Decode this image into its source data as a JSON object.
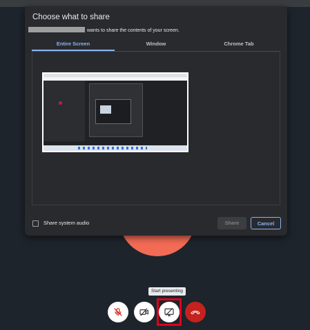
{
  "dialog": {
    "title": "Choose what to share",
    "subtitle": "wants to share the contents of your screen.",
    "tabs": [
      {
        "label": "Entire Screen",
        "active": true
      },
      {
        "label": "Window",
        "active": false
      },
      {
        "label": "Chrome Tab",
        "active": false
      }
    ],
    "share_audio_label": "Share system audio",
    "share_audio_checked": false,
    "share_button": "Share",
    "cancel_button": "Cancel"
  },
  "call_controls": {
    "tooltip": "Start presenting",
    "buttons": [
      {
        "icon": "mic-off-icon"
      },
      {
        "icon": "camera-off-icon"
      },
      {
        "icon": "present-screen-icon"
      },
      {
        "icon": "hang-up-icon"
      }
    ]
  },
  "colors": {
    "background": "#1e242c",
    "dialog": "#292a2d",
    "accent": "#8ab4f8",
    "avatar": "#f26b55",
    "hangup": "#c5221f",
    "highlight": "#e0001b"
  }
}
